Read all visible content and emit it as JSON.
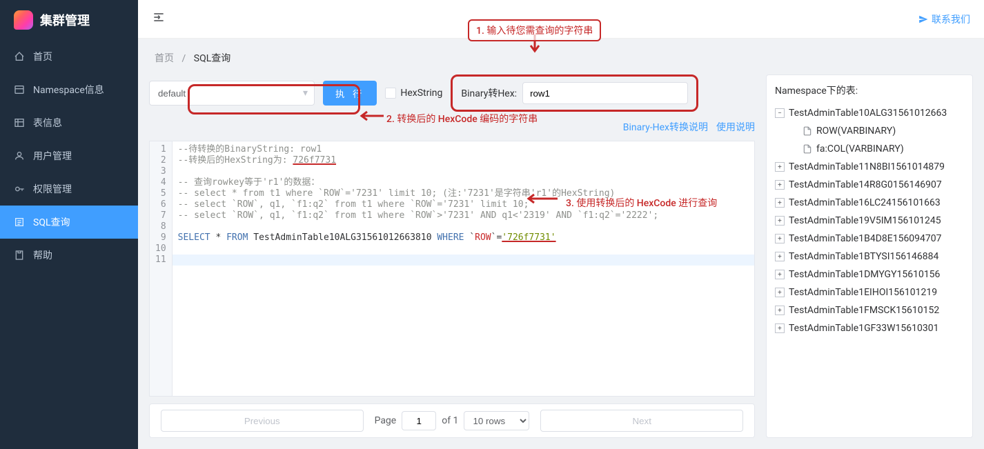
{
  "logo_text": "集群管理",
  "contact_us": "联系我们",
  "sidebar": {
    "items": [
      {
        "icon": "home",
        "label": "首页"
      },
      {
        "icon": "namespace",
        "label": "Namespace信息"
      },
      {
        "icon": "table",
        "label": "表信息"
      },
      {
        "icon": "user",
        "label": "用户管理"
      },
      {
        "icon": "perm",
        "label": "权限管理"
      },
      {
        "icon": "sql",
        "label": "SQL查询"
      },
      {
        "icon": "help",
        "label": "帮助"
      }
    ]
  },
  "breadcrumb": {
    "home": "首页",
    "sep": "/",
    "current": "SQL查询"
  },
  "toolbar": {
    "namespace_selected": "default",
    "execute_label": "执 行",
    "hexstring_label": "HexString",
    "binary2hex_label": "Binary转Hex:",
    "binary2hex_value": "row1",
    "link_binaryhex": "Binary-Hex转换说明",
    "link_usage": "使用说明"
  },
  "editor": {
    "lines": [
      "--待转换的BinaryString: row1",
      "--转换后的HexString为: 726f7731",
      "",
      "-- 查询rowkey等于'r1'的数据：",
      "-- select * from t1 where `ROW`='7231' limit 10; (注:'7231'是字符串'r1'的HexString)",
      "-- select `ROW`, q1, `f1:q2` from t1 where `ROW`='7231' limit 10;",
      "-- select `ROW`, q1, `f1:q2` from t1 where `ROW`>'7231' AND q1<'2319' AND `f1:q2`='2222';",
      "",
      "SELECT * FROM TestAdminTable10ALG31561012663810 WHERE `ROW`='726f7731'",
      "",
      ""
    ]
  },
  "pager": {
    "prev": "Previous",
    "next": "Next",
    "page_label": "Page",
    "page_value": "1",
    "of_label": "of 1",
    "rows_label": "10 rows"
  },
  "tree": {
    "title": "Namespace下的表:",
    "expanded_table": "TestAdminTable10ALG31561012663",
    "columns": [
      "ROW(VARBINARY)",
      "fa:COL(VARBINARY)"
    ],
    "tables": [
      "TestAdminTable11N8BI1561014879",
      "TestAdminTable14R8G0156146907",
      "TestAdminTable16LC24156101663",
      "TestAdminTable19V5IM156101245",
      "TestAdminTable1B4D8E156094707",
      "TestAdminTable1BTYSI156146884",
      "TestAdminTable1DMYGY15610156",
      "TestAdminTable1EIHOI156101219",
      "TestAdminTable1FMSCK15610152",
      "TestAdminTable1GF33W15610301"
    ]
  },
  "annotations": {
    "a1": "1. 输入待您需查询的字符串",
    "a2": "2. 转换后的 HexCode 编码的字符串",
    "a3": "3. 使用转换后的 HexCode 进行查询"
  }
}
